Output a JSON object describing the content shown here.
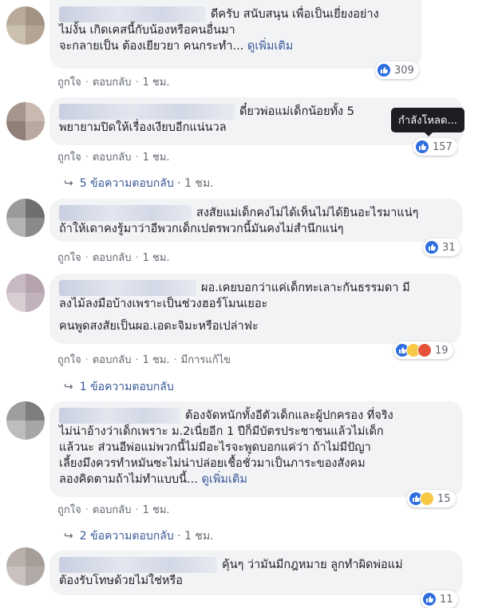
{
  "comments": [
    {
      "lines": [
        "ดีครับ สนับสนุน เพื่อเป็นเยี่ยงอย่าง\nไม่งั้น เกิดเคสนี้กับน้องหรือคนอื่นมา\nจะกลายเป็น ต้องเยียวยา คนกระทำ..."
      ],
      "see_more": "ดูเพิ่มเติม",
      "like": "ถูกใจ",
      "reply": "ตอบกลับ",
      "time": "1 ชม.",
      "reaction_count": "309"
    },
    {
      "lines": [
        "ดี๋ยวพ่อแม่เด็กน้อยทั้ง 5\nพยายามปิดให้เรื่องเงียบอีกแน่นวล"
      ],
      "like": "ถูกใจ",
      "reply": "ตอบกลับ",
      "time": "1 ชม.",
      "reaction_count": "157",
      "replies_label": "5 ข้อความตอบกลับ",
      "replies_time": "1 ชม."
    },
    {
      "lines": [
        "สงสัยแม่เด็กคงไม่ได้เห็นไม่ได้ยินอะไรมาแน่ๆ\nถ้าให้เดาคงรู้มาว่าอีพวกเด็กเปตรพวกนี้มันคงไม่สำนึกแน่ๆ"
      ],
      "like": "ถูกใจ",
      "reply": "ตอบกลับ",
      "time": "1 ชม.",
      "reaction_count": "31"
    },
    {
      "lines": [
        "ผอ.เคยบอกว่าแค่เด็กทะเลาะกันธรรมดา มี\nลงไม้ลงมือบ้างเพราะเป็นช่วงฮอร์โมนเยอะ",
        "คนพูดสงสัยเป็นผอ.เอดะจิมะหรือเปล่าฟะ"
      ],
      "like": "ถูกใจ",
      "reply": "ตอบกลับ",
      "time": "1 ชม.",
      "edited": "มีการแก้ไข",
      "reaction_count": "19",
      "replies_label": "1 ข้อความตอบกลับ"
    },
    {
      "lines": [
        "ต้องจัดหนักทั้งอีตัวเด็กและผู้ปกครอง ที่จริง\nไม่น่าอ้างว่าเด็กเพราะ ม.2เนี่ยอีก 1 ปีก็มีบัตรประชาชนแล้วไม่เด็ก\nแล้วนะ ส่วนอีพ่อแม่พวกนี้ไม่มีอะไรจะพูดบอกแค่ว่า ถ้าไม่มีปัญา\nเลี้ยงมึงควรทำหมันซะไม่น่าปล่อยเชื้อชั่วมาเป็นภาระของสังคม\nลองคิดตามถ้าไม่ทำแบบนี้..."
      ],
      "see_more": "ดูเพิ่มเติม",
      "like": "ถูกใจ",
      "reply": "ตอบกลับ",
      "time": "1 ชม.",
      "reaction_count": "15",
      "replies_label": "2 ข้อความตอบกลับ",
      "replies_time": "1 ชม."
    },
    {
      "lines": [
        "คุ้นๆ ว่ามันมีกฎหมาย ลูกทำผิดพ่อแม่\nต้องรับโทษด้วยไม่ใช่หรือ"
      ],
      "like": "ถูกใจ",
      "reply": "ตอบกลับ",
      "time": "1 ชม.",
      "reaction_count": "11"
    }
  ],
  "tooltip": "กำลังโหลด...",
  "colors": {
    "bubble": "#f2f3f5",
    "link": "#385898",
    "meta": "#606770",
    "like": "#2e6ee0"
  }
}
